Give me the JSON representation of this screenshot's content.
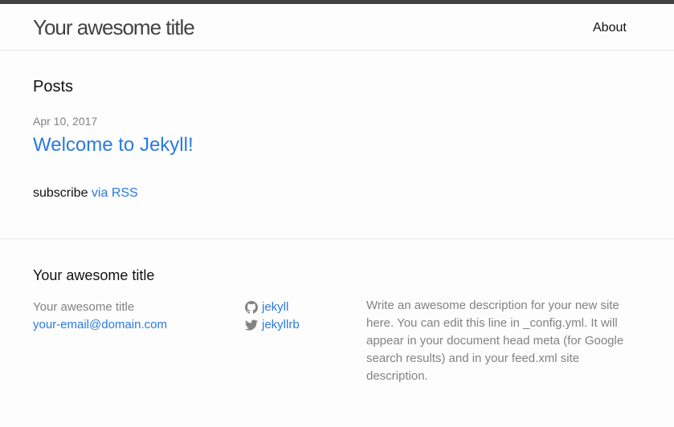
{
  "header": {
    "site_title": "Your awesome title",
    "nav": [
      {
        "label": "About"
      }
    ]
  },
  "main": {
    "heading": "Posts",
    "posts": [
      {
        "date": "Apr 10, 2017",
        "title": "Welcome to Jekyll!"
      }
    ],
    "subscribe": {
      "prefix": "subscribe ",
      "link_label": "via RSS"
    }
  },
  "footer": {
    "heading": "Your awesome title",
    "name": "Your awesome title",
    "email": "your-email@domain.com",
    "social": [
      {
        "icon": "github-icon",
        "label": "jekyll"
      },
      {
        "icon": "twitter-icon",
        "label": "jekyllrb"
      }
    ],
    "description": "Write an awesome description for your new site here. You can edit this line in _config.yml. It will appear in your document head meta (for Google search results) and in your feed.xml site description."
  },
  "colors": {
    "link": "#2a7ae2",
    "text": "#111111",
    "muted": "#828282",
    "border": "#e8e8e8",
    "top_stripe": "#424242"
  }
}
